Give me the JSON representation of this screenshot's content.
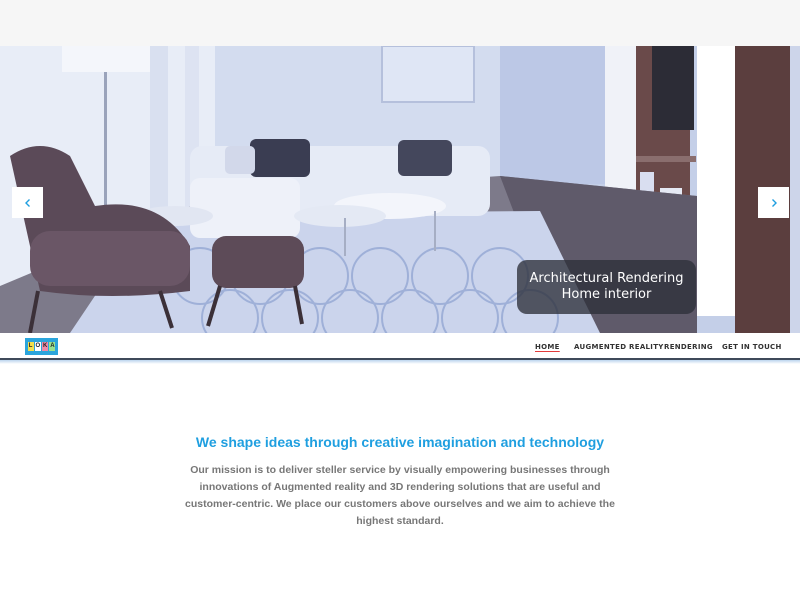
{
  "hero": {
    "caption_line1": "Architectural Rendering",
    "caption_line2": "Home interior",
    "prev_icon": "chevron-left-icon",
    "next_icon": "chevron-right-icon"
  },
  "logo": {
    "letters": [
      "L",
      "O",
      "K",
      "A"
    ]
  },
  "nav": {
    "items": [
      {
        "label": "HOME",
        "active": true
      },
      {
        "label": "AUGMENTED REALITY",
        "active": false
      },
      {
        "label": "RENDERING",
        "active": false
      },
      {
        "label": "GET IN TOUCH",
        "active": false
      }
    ],
    "active_underline_color": "#e23b3b"
  },
  "main": {
    "headline": "We shape ideas through creative imagination and technology",
    "mission": "Our mission is to deliver steller service by visually empowering businesses through innovations of Augmented reality and 3D rendering solutions that are useful and customer-centric. We place our customers above ourselves and we aim to achieve the highest standard."
  },
  "colors": {
    "accent": "#1f9fe0",
    "body_text": "#777777",
    "logo_bg": "#2ba5dc"
  }
}
